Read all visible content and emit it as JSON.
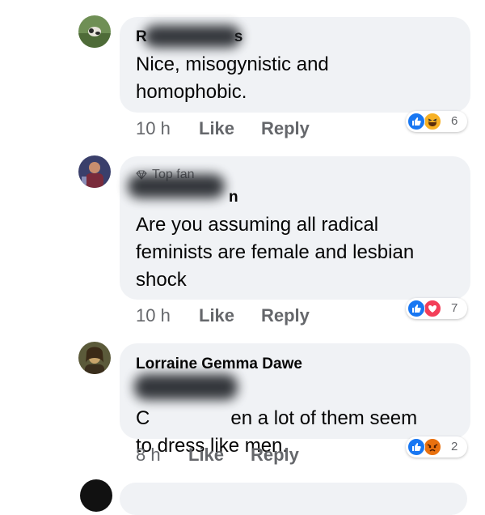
{
  "comments": [
    {
      "author": "R",
      "author_suffix": "s",
      "text": "Nice, misogynistic and\nhomophobic.",
      "time": "10 h",
      "like_label": "Like",
      "reply_label": "Reply",
      "reactions": [
        "like",
        "haha"
      ],
      "reaction_count": "6"
    },
    {
      "badge": "Top fan",
      "author_suffix": "n",
      "text": "Are you assuming all radical\nfeminists are female and lesbian\nshock",
      "time": "10 h",
      "like_label": "Like",
      "reply_label": "Reply",
      "reactions": [
        "like",
        "love"
      ],
      "reaction_count": "7"
    },
    {
      "author": "Lorraine Gemma Dawe",
      "mention_prefix": "C",
      "mention_suffix": "en",
      "text_rest": " a lot of them seem",
      "text_line2": "to dress like men.",
      "time": "8 h",
      "like_label": "Like",
      "reply_label": "Reply",
      "reactions": [
        "like",
        "angry"
      ],
      "reaction_count": "2"
    }
  ],
  "colors": {
    "bubble": "#f0f2f5",
    "meta_text": "#65676b",
    "like_blue": "#1877f2",
    "love_red": "#f33e58",
    "haha_yellow": "#f7b125",
    "angry_orange": "#e9710f"
  }
}
